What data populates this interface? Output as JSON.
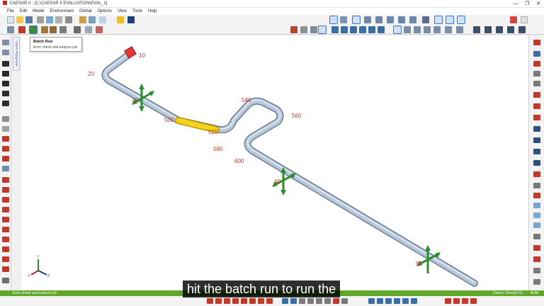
{
  "window": {
    "title": "CAESAR II - [C:\\CAESAR II EVALUATION\\EVAL_1]",
    "controls": [
      "—",
      "❐",
      "✕"
    ]
  },
  "menu": [
    "File",
    "Edit",
    "Model",
    "Environment",
    "Global",
    "Options",
    "View",
    "Tools",
    "Help"
  ],
  "left_panel_tab": "Classic Piping Input",
  "tooltip": {
    "title": "Batch Run",
    "description": "Error check and analyze job"
  },
  "nodes": [
    "10",
    "20",
    "30",
    "40",
    "50",
    "500",
    "520",
    "540",
    "560",
    "580",
    "600"
  ],
  "status": {
    "left": "Error check and analyze job",
    "right": "Dimen: Direct(F11)",
    "mode": "NUM"
  },
  "subtitle": "hit the batch run to run the",
  "colors": {
    "pipe": "#a9bed3",
    "highlight": "#f4d41a",
    "anchor": "#e53935",
    "restraint": "#2e8b2e",
    "statusbar": "#5fa82a",
    "node_label": "#c0392b"
  },
  "icons": [
    "batch-run-icon",
    "new-file-icon",
    "open-file-icon",
    "save-icon",
    "print-icon",
    "zoom-icon",
    "rotate-icon",
    "select-icon"
  ]
}
